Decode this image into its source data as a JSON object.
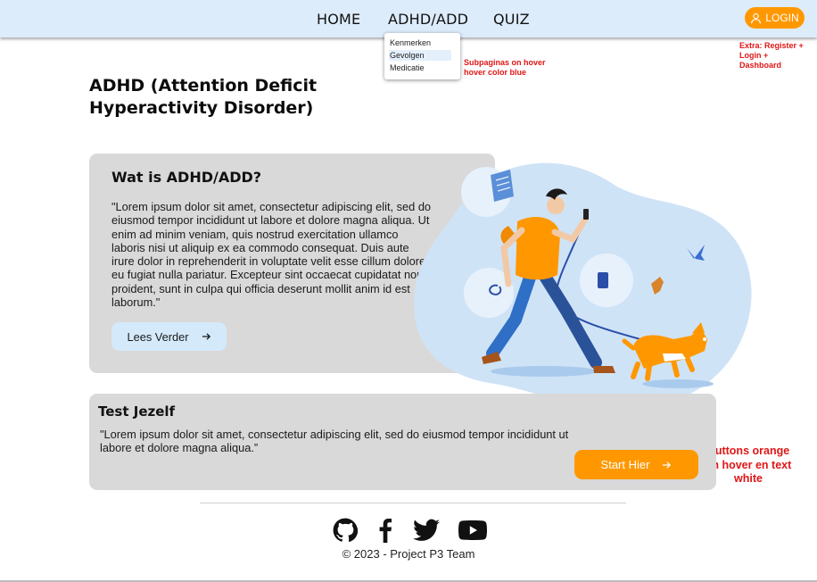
{
  "nav": {
    "items": [
      "HOME",
      "ADHD/ADD",
      "QUIZ"
    ],
    "login_label": "LOGIN",
    "dropdown": [
      "Kenmerken",
      "Gevolgen",
      "Medicatie"
    ]
  },
  "notes": {
    "login_note": "Extra: Register + Login + Dashboard",
    "dropdown_note": "Subpaginas on hover hover color blue",
    "button_note": "Buttons orange on hover en text white"
  },
  "page_title": "ADHD (Attention Deficit Hyperactivity Disorder)",
  "section1": {
    "title": "Wat is ADHD/ADD?",
    "body": "\"Lorem ipsum dolor sit amet, consectetur adipiscing elit, sed do eiusmod tempor incididunt ut labore et dolore magna aliqua. Ut enim ad minim veniam, quis nostrud exercitation ullamco laboris nisi ut aliquip ex ea commodo consequat. Duis aute irure dolor in reprehenderit in voluptate velit esse cillum dolore eu fugiat nulla pariatur. Excepteur sint occaecat cupidatat non proident, sunt in culpa qui officia deserunt mollit anim id est laborum.\"",
    "button_label": "Lees Verder"
  },
  "section2": {
    "title": "Test Jezelf",
    "body": "\"Lorem ipsum dolor sit amet, consectetur adipiscing elit, sed do eiusmod tempor incididunt ut labore et dolore magna aliqua.”",
    "button_label": "Start Hier"
  },
  "footer": {
    "social_icons": [
      "github-icon",
      "facebook-icon",
      "twitter-icon",
      "youtube-icon"
    ],
    "copyright": "© 2023 - Project P3 Team"
  },
  "colors": {
    "nav_bg": "#dcecfb",
    "accent_orange": "#ff9800",
    "card_bg": "#d9d9d9",
    "hover_blue": "#e3effb",
    "note_red": "#e01616"
  }
}
